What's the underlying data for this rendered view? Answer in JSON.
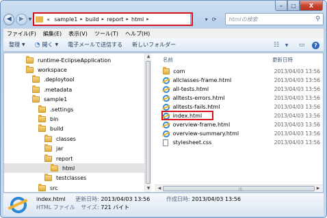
{
  "window": {
    "caption_buttons": [
      "–",
      "□",
      "X"
    ]
  },
  "address": {
    "overflow": "«",
    "crumbs": [
      "sample1",
      "build",
      "report",
      "html"
    ],
    "search_placeholder": "htmlの検索"
  },
  "menubar": [
    "ファイル(F)",
    "編集(E)",
    "表示(V)",
    "ツール(T)",
    "ヘルプ(H)"
  ],
  "toolbar": {
    "organize": "整理",
    "open": "開く",
    "email": "電子メールで送信する",
    "new_folder": "新しいフォルダー"
  },
  "tree": [
    {
      "label": "runtime-EclipseApplication",
      "depth": 1
    },
    {
      "label": "workspace",
      "depth": 1
    },
    {
      "label": ".deploytool",
      "depth": 2
    },
    {
      "label": ".metadata",
      "depth": 2
    },
    {
      "label": "sample1",
      "depth": 2
    },
    {
      "label": ".settings",
      "depth": 3
    },
    {
      "label": "bin",
      "depth": 3
    },
    {
      "label": "build",
      "depth": 3
    },
    {
      "label": "classes",
      "depth": 4
    },
    {
      "label": "jar",
      "depth": 4
    },
    {
      "label": "report",
      "depth": 4
    },
    {
      "label": "html",
      "depth": 5,
      "selected": true
    },
    {
      "label": "testclasses",
      "depth": 4
    },
    {
      "label": "src",
      "depth": 3
    }
  ],
  "columns": {
    "name": "名前",
    "modified": "更新日時"
  },
  "files": [
    {
      "name": "com",
      "date": "2013/04/03 13:56",
      "icon": "folder"
    },
    {
      "name": "allclasses-frame.html",
      "date": "2013/04/03 13:56",
      "icon": "ie"
    },
    {
      "name": "all-tests.html",
      "date": "2013/04/03 13:56",
      "icon": "ie"
    },
    {
      "name": "alltests-errors.html",
      "date": "2013/04/03 13:56",
      "icon": "ie"
    },
    {
      "name": "alltests-fails.html",
      "date": "2013/04/03 13:56",
      "icon": "ie"
    },
    {
      "name": "index.html",
      "date": "2013/04/03 13:56",
      "icon": "ie",
      "highlighted": true
    },
    {
      "name": "overview-frame.html",
      "date": "2013/04/03 13:56",
      "icon": "ie"
    },
    {
      "name": "overview-summary.html",
      "date": "2013/04/03 13:56",
      "icon": "ie"
    },
    {
      "name": "stylesheet.css",
      "date": "2013/04/03 13:56",
      "icon": "css"
    }
  ],
  "details": {
    "filename": "index.html",
    "modified_label": "更新日時:",
    "modified_value": "2013/04/03 13:56",
    "created_label": "作成日時:",
    "created_value": "2013/04/03 13:56",
    "type": "HTML ファイル",
    "size_label": "サイズ:",
    "size_value": "721 バイト"
  }
}
